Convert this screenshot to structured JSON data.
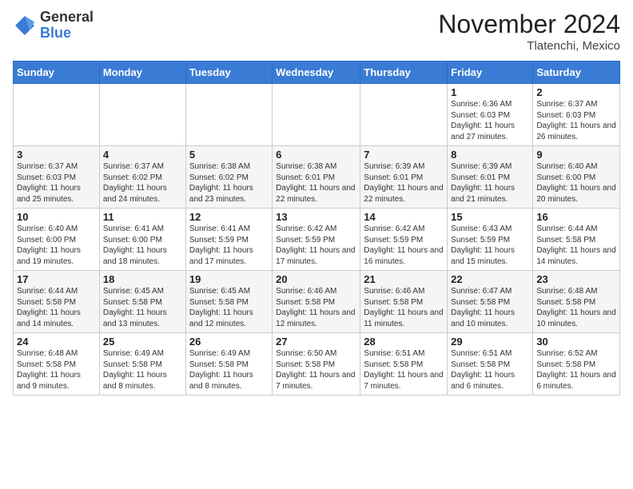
{
  "header": {
    "logo_general": "General",
    "logo_blue": "Blue",
    "month_title": "November 2024",
    "location": "Tlatenchi, Mexico"
  },
  "weekdays": [
    "Sunday",
    "Monday",
    "Tuesday",
    "Wednesday",
    "Thursday",
    "Friday",
    "Saturday"
  ],
  "weeks": [
    [
      {
        "day": "",
        "info": ""
      },
      {
        "day": "",
        "info": ""
      },
      {
        "day": "",
        "info": ""
      },
      {
        "day": "",
        "info": ""
      },
      {
        "day": "",
        "info": ""
      },
      {
        "day": "1",
        "info": "Sunrise: 6:36 AM\nSunset: 6:03 PM\nDaylight: 11 hours and 27 minutes."
      },
      {
        "day": "2",
        "info": "Sunrise: 6:37 AM\nSunset: 6:03 PM\nDaylight: 11 hours and 26 minutes."
      }
    ],
    [
      {
        "day": "3",
        "info": "Sunrise: 6:37 AM\nSunset: 6:03 PM\nDaylight: 11 hours and 25 minutes."
      },
      {
        "day": "4",
        "info": "Sunrise: 6:37 AM\nSunset: 6:02 PM\nDaylight: 11 hours and 24 minutes."
      },
      {
        "day": "5",
        "info": "Sunrise: 6:38 AM\nSunset: 6:02 PM\nDaylight: 11 hours and 23 minutes."
      },
      {
        "day": "6",
        "info": "Sunrise: 6:38 AM\nSunset: 6:01 PM\nDaylight: 11 hours and 22 minutes."
      },
      {
        "day": "7",
        "info": "Sunrise: 6:39 AM\nSunset: 6:01 PM\nDaylight: 11 hours and 22 minutes."
      },
      {
        "day": "8",
        "info": "Sunrise: 6:39 AM\nSunset: 6:01 PM\nDaylight: 11 hours and 21 minutes."
      },
      {
        "day": "9",
        "info": "Sunrise: 6:40 AM\nSunset: 6:00 PM\nDaylight: 11 hours and 20 minutes."
      }
    ],
    [
      {
        "day": "10",
        "info": "Sunrise: 6:40 AM\nSunset: 6:00 PM\nDaylight: 11 hours and 19 minutes."
      },
      {
        "day": "11",
        "info": "Sunrise: 6:41 AM\nSunset: 6:00 PM\nDaylight: 11 hours and 18 minutes."
      },
      {
        "day": "12",
        "info": "Sunrise: 6:41 AM\nSunset: 5:59 PM\nDaylight: 11 hours and 17 minutes."
      },
      {
        "day": "13",
        "info": "Sunrise: 6:42 AM\nSunset: 5:59 PM\nDaylight: 11 hours and 17 minutes."
      },
      {
        "day": "14",
        "info": "Sunrise: 6:42 AM\nSunset: 5:59 PM\nDaylight: 11 hours and 16 minutes."
      },
      {
        "day": "15",
        "info": "Sunrise: 6:43 AM\nSunset: 5:59 PM\nDaylight: 11 hours and 15 minutes."
      },
      {
        "day": "16",
        "info": "Sunrise: 6:44 AM\nSunset: 5:58 PM\nDaylight: 11 hours and 14 minutes."
      }
    ],
    [
      {
        "day": "17",
        "info": "Sunrise: 6:44 AM\nSunset: 5:58 PM\nDaylight: 11 hours and 14 minutes."
      },
      {
        "day": "18",
        "info": "Sunrise: 6:45 AM\nSunset: 5:58 PM\nDaylight: 11 hours and 13 minutes."
      },
      {
        "day": "19",
        "info": "Sunrise: 6:45 AM\nSunset: 5:58 PM\nDaylight: 11 hours and 12 minutes."
      },
      {
        "day": "20",
        "info": "Sunrise: 6:46 AM\nSunset: 5:58 PM\nDaylight: 11 hours and 12 minutes."
      },
      {
        "day": "21",
        "info": "Sunrise: 6:46 AM\nSunset: 5:58 PM\nDaylight: 11 hours and 11 minutes."
      },
      {
        "day": "22",
        "info": "Sunrise: 6:47 AM\nSunset: 5:58 PM\nDaylight: 11 hours and 10 minutes."
      },
      {
        "day": "23",
        "info": "Sunrise: 6:48 AM\nSunset: 5:58 PM\nDaylight: 11 hours and 10 minutes."
      }
    ],
    [
      {
        "day": "24",
        "info": "Sunrise: 6:48 AM\nSunset: 5:58 PM\nDaylight: 11 hours and 9 minutes."
      },
      {
        "day": "25",
        "info": "Sunrise: 6:49 AM\nSunset: 5:58 PM\nDaylight: 11 hours and 8 minutes."
      },
      {
        "day": "26",
        "info": "Sunrise: 6:49 AM\nSunset: 5:58 PM\nDaylight: 11 hours and 8 minutes."
      },
      {
        "day": "27",
        "info": "Sunrise: 6:50 AM\nSunset: 5:58 PM\nDaylight: 11 hours and 7 minutes."
      },
      {
        "day": "28",
        "info": "Sunrise: 6:51 AM\nSunset: 5:58 PM\nDaylight: 11 hours and 7 minutes."
      },
      {
        "day": "29",
        "info": "Sunrise: 6:51 AM\nSunset: 5:58 PM\nDaylight: 11 hours and 6 minutes."
      },
      {
        "day": "30",
        "info": "Sunrise: 6:52 AM\nSunset: 5:58 PM\nDaylight: 11 hours and 6 minutes."
      }
    ]
  ]
}
